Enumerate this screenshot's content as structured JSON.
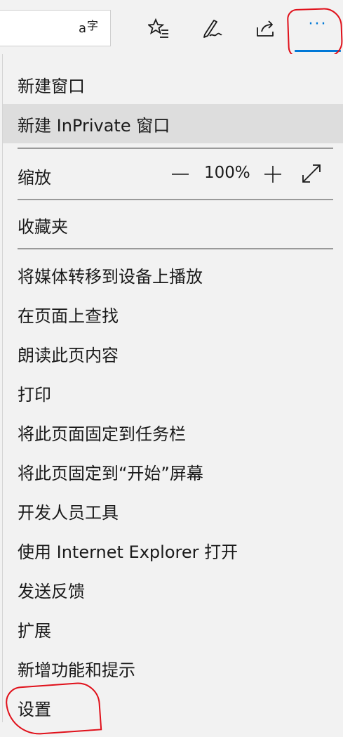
{
  "toolbar": {
    "address_icon": "translate-icon",
    "icons": [
      "favorites-star-icon",
      "pen-icon",
      "share-icon"
    ],
    "more_label": "···",
    "accent": "#0078d7"
  },
  "menu": {
    "new_window": "新建窗口",
    "new_inprivate": "新建 InPrivate 窗口",
    "zoom": {
      "label": "缩放",
      "minus": "—",
      "value": "100%",
      "plus": "+"
    },
    "favorites": "收藏夹",
    "items": [
      "将媒体转移到设备上播放",
      "在页面上查找",
      "朗读此页内容",
      "打印",
      "将此页面固定到任务栏",
      "将此页固定到“开始”屏幕",
      "开发人员工具",
      "使用 Internet Explorer 打开",
      "发送反馈",
      "扩展",
      "新增功能和提示",
      "设置"
    ]
  },
  "annotation_color": "#e0101a"
}
